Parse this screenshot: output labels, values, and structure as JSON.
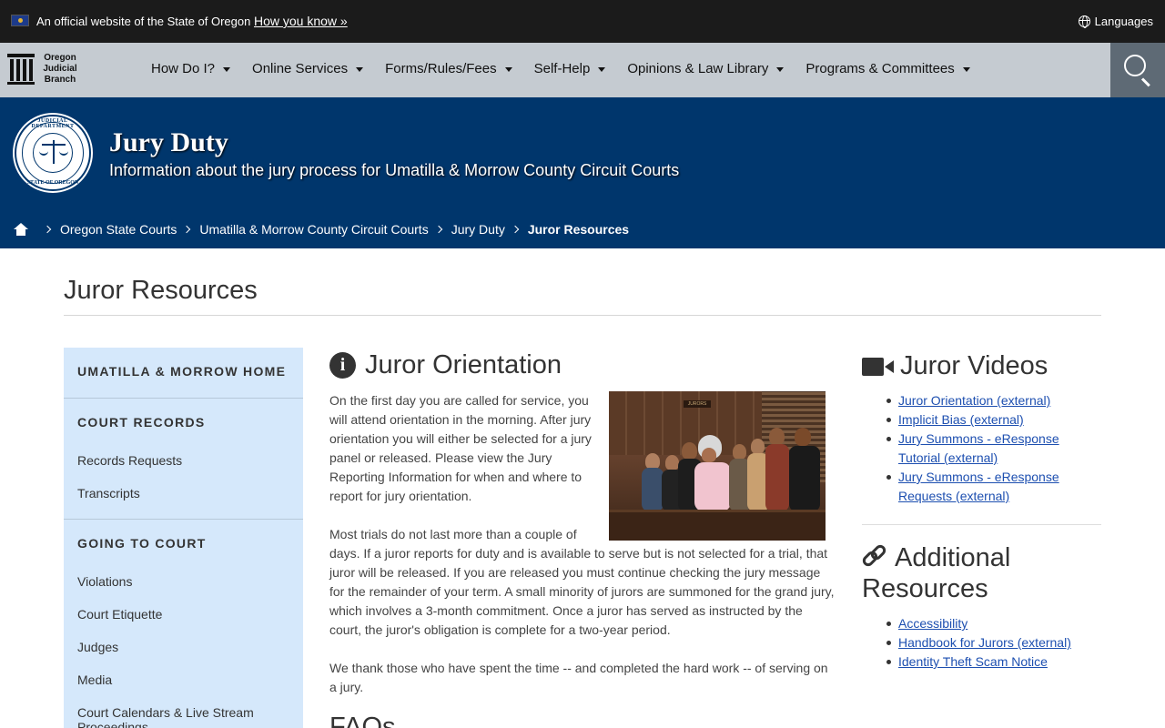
{
  "official_banner": {
    "text": "An official website of the State of Oregon",
    "how_you_know": "How you know »",
    "languages": "Languages"
  },
  "nav": {
    "logo_lines": [
      "Oregon",
      "Judicial",
      "Branch"
    ],
    "items": [
      {
        "label": "How Do I?"
      },
      {
        "label": "Online Services"
      },
      {
        "label": "Forms/Rules/Fees"
      },
      {
        "label": "Self-Help"
      },
      {
        "label": "Opinions & Law Library"
      },
      {
        "label": "Programs & Committees"
      }
    ]
  },
  "hero": {
    "title": "Jury Duty",
    "subtitle": "Information about the jury process for Umatilla & Morrow County Circuit Courts",
    "seal_top": "JUDICIAL DEPARTMENT",
    "seal_bottom": "STATE OF OREGON"
  },
  "breadcrumb": [
    "Oregon State Courts",
    "Umatilla & Morrow County Circuit Courts",
    "Jury Duty",
    "Juror Resources"
  ],
  "page_title": "Juror Resources",
  "sidebar": {
    "home": "UMATILLA & MORROW HOME",
    "court_records": "COURT RECORDS",
    "records_links": [
      "Records Requests",
      "Transcripts"
    ],
    "going_to_court": "GOING TO COURT",
    "court_links": [
      "Violations",
      "Court Etiquette",
      "Judges",
      "Media",
      "Court Calendars & Live Stream Proceedings"
    ]
  },
  "main": {
    "heading": "Juror Orientation",
    "p1_lines": [
      "On the first day you are called for service, you",
      "will attend orientation in the morning. After jury",
      "orientation you will either be selected for a jury",
      "panel or released. Please view the Jury",
      "Reporting Information for when and where to",
      "report for jury orientation."
    ],
    "p2_lines": [
      "Most trials do not last more than a couple of",
      "days. If a juror reports for duty and is available to serve but is not selected for a trial, that",
      "juror will be released. If you are released you must continue checking the jury message",
      "for the remainder of your term. A small minority of jurors are summoned for the grand jury,",
      "which involves a 3-month commitment. Once a juror has served as instructed by the",
      "court, the juror's obligation is complete for a two-year period."
    ],
    "p3_lines": [
      "We thank those who have spent the time -- and completed the hard work -- of serving on",
      "a jury."
    ],
    "photo_sign": "JURORS",
    "faq_heading": "FAQs"
  },
  "right": {
    "videos_heading": "Juror Videos",
    "videos": [
      "Juror Orientation (external)",
      "Implicit Bias (external)",
      "Jury Summons - eResponse Tutorial (external)",
      "Jury Summons - eResponse Requests (external)"
    ],
    "resources_heading_1": "Additional",
    "resources_heading_2": "Resources",
    "resources": [
      "Accessibility",
      "Handbook for Jurors (external)",
      "Identity Theft Scam Notice"
    ]
  }
}
